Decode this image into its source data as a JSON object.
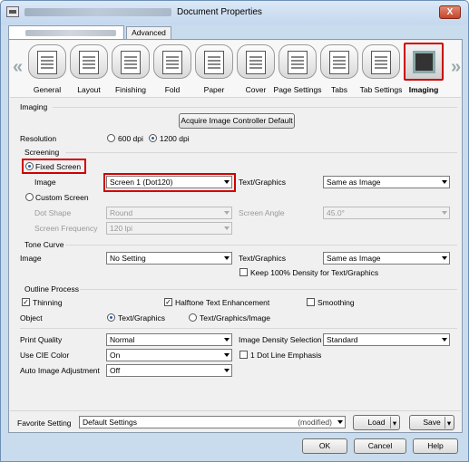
{
  "window": {
    "title": "Document Properties",
    "close": "X"
  },
  "tabs": [
    "",
    "Advanced"
  ],
  "icons": [
    "General",
    "Layout",
    "Finishing",
    "Fold",
    "Paper",
    "Cover",
    "Page Settings",
    "Tabs",
    "Tab Settings",
    "Imaging"
  ],
  "imaging": {
    "section": "Imaging",
    "acquire_btn": "Acquire Image Controller Default",
    "resolution_label": "Resolution",
    "res_600": "600 dpi",
    "res_1200": "1200 dpi"
  },
  "screening": {
    "section": "Screening",
    "fixed": "Fixed Screen",
    "image_label": "Image",
    "image_val": "Screen 1 (Dot120)",
    "tg_label": "Text/Graphics",
    "tg_val": "Same as Image",
    "custom": "Custom Screen",
    "dot_shape_label": "Dot Shape",
    "dot_shape_val": "Round",
    "angle_label": "Screen Angle",
    "angle_val": "45.0°",
    "freq_label": "Screen Frequency",
    "freq_val": "120 lpi"
  },
  "tone": {
    "section": "Tone Curve",
    "image_label": "Image",
    "image_val": "No Setting",
    "tg_label": "Text/Graphics",
    "tg_val": "Same as Image",
    "keep": "Keep 100% Density for Text/Graphics"
  },
  "outline": {
    "section": "Outline Process",
    "thinning": "Thinning",
    "halftone": "Halftone Text Enhancement",
    "smoothing": "Smoothing",
    "object_label": "Object",
    "obj1": "Text/Graphics",
    "obj2": "Text/Graphics/Image"
  },
  "misc": {
    "pq_label": "Print Quality",
    "pq_val": "Normal",
    "ids_label": "Image Density Selection",
    "ids_val": "Standard",
    "cie_label": "Use CIE Color",
    "cie_val": "On",
    "dot_line": "1 Dot Line Emphasis",
    "auto_label": "Auto Image Adjustment",
    "auto_val": "Off"
  },
  "favorite": {
    "label": "Favorite Setting",
    "value": "Default Settings",
    "modified": "(modified)",
    "load": "Load",
    "save": "Save"
  },
  "footer": {
    "ok": "OK",
    "cancel": "Cancel",
    "help": "Help"
  },
  "colors": {
    "highlight": "#d40000",
    "title_bg": "#c4d8ee"
  }
}
